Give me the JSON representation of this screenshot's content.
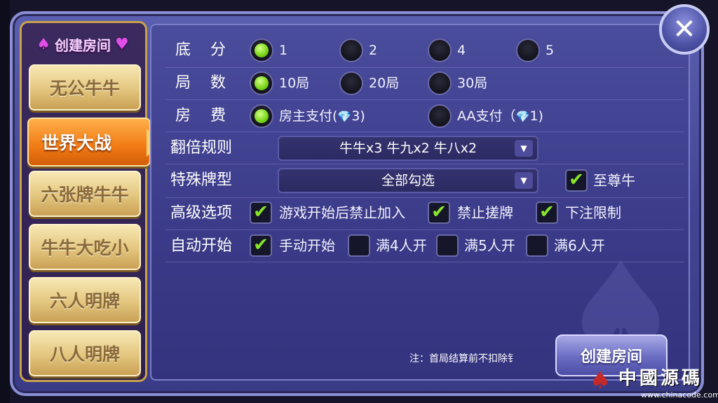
{
  "sidebar": {
    "title": "创建房间",
    "tabs": [
      {
        "label": "无公牛牛",
        "active": false
      },
      {
        "label": "世界大战",
        "active": true
      },
      {
        "label": "六张牌牛牛",
        "active": false
      },
      {
        "label": "牛牛大吃小",
        "active": false
      },
      {
        "label": "六人明牌",
        "active": false
      },
      {
        "label": "八人明牌",
        "active": false
      }
    ]
  },
  "settings": {
    "base_score": {
      "label": "底分",
      "options": [
        "1",
        "2",
        "4",
        "5"
      ],
      "selected": "1"
    },
    "rounds": {
      "label": "局数",
      "options": [
        "10局",
        "20局",
        "30局"
      ],
      "selected": "10局"
    },
    "fee": {
      "label": "房费",
      "options": [
        {
          "text": "房主支付(",
          "gem_count": "3)"
        },
        {
          "text": "AA支付（",
          "gem_count": "1)"
        }
      ],
      "selected": "房主支付"
    },
    "multiplier": {
      "label": "翻倍规则",
      "value": "牛牛x3 牛九x2 牛八x2"
    },
    "special": {
      "label": "特殊牌型",
      "value": "全部勾选",
      "checkbox_label": "至尊牛",
      "checked": true
    },
    "advanced": {
      "label": "高级选项",
      "options": [
        {
          "label": "游戏开始后禁止加入",
          "checked": true
        },
        {
          "label": "禁止搓牌",
          "checked": true
        },
        {
          "label": "下注限制",
          "checked": true
        }
      ]
    },
    "auto_start": {
      "label": "自动开始",
      "options": [
        {
          "label": "手动开始",
          "checked": true
        },
        {
          "label": "满4人开",
          "checked": false
        },
        {
          "label": "满5人开",
          "checked": false
        },
        {
          "label": "满6人开",
          "checked": false
        }
      ]
    }
  },
  "note": "注：首局结算前不扣除钅",
  "create_button": "创建房间",
  "watermark": {
    "text": "中國源碼",
    "url": "www.chinacode.com"
  },
  "colors": {
    "accent_orange": "#f07a14",
    "radio_on": "#7fd81e",
    "panel": "#434594"
  }
}
